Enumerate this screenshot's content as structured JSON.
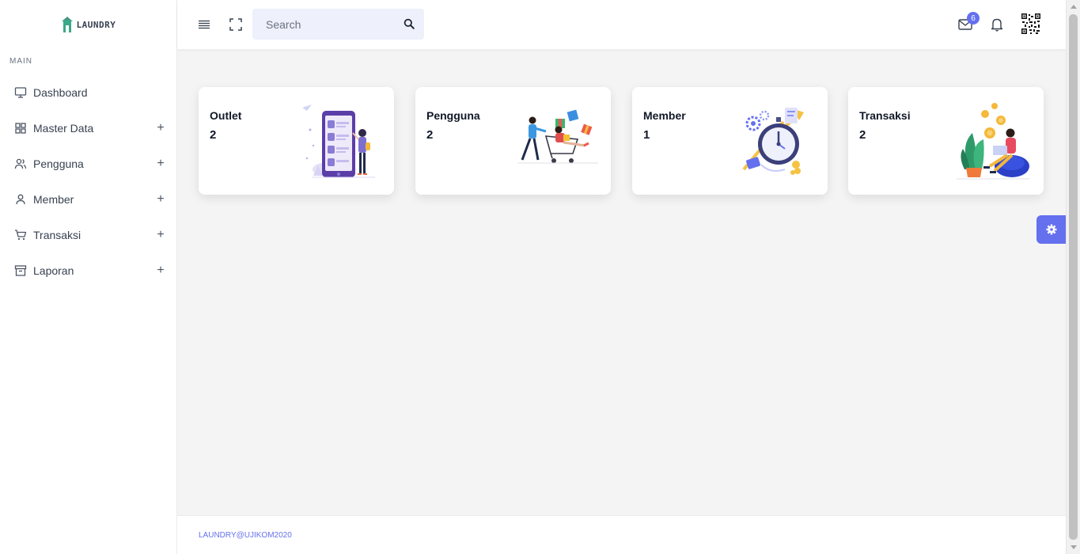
{
  "brand": {
    "logo_text": "LAUNDRY"
  },
  "sidebar": {
    "section": "MAIN",
    "items": [
      {
        "label": "Dashboard",
        "icon": "monitor-icon",
        "expandable": false
      },
      {
        "label": "Master Data",
        "icon": "grid-icon",
        "expandable": true
      },
      {
        "label": "Pengguna",
        "icon": "users-icon",
        "expandable": true
      },
      {
        "label": "Member",
        "icon": "user-icon",
        "expandable": true
      },
      {
        "label": "Transaksi",
        "icon": "cart-icon",
        "expandable": true
      },
      {
        "label": "Laporan",
        "icon": "archive-icon",
        "expandable": true
      }
    ],
    "expand_symbol": "+"
  },
  "header": {
    "search_placeholder": "Search",
    "mail_badge": "6"
  },
  "cards": [
    {
      "title": "Outlet",
      "value": "2",
      "illustration": "phone-illustration"
    },
    {
      "title": "Pengguna",
      "value": "2",
      "illustration": "shopping-illustration"
    },
    {
      "title": "Member",
      "value": "1",
      "illustration": "stopwatch-illustration"
    },
    {
      "title": "Transaksi",
      "value": "2",
      "illustration": "coins-illustration"
    }
  ],
  "footer": {
    "text": "LAUNDRY@UJIKOM2020"
  },
  "colors": {
    "accent": "#6470ee",
    "background": "#f4f4f5"
  }
}
